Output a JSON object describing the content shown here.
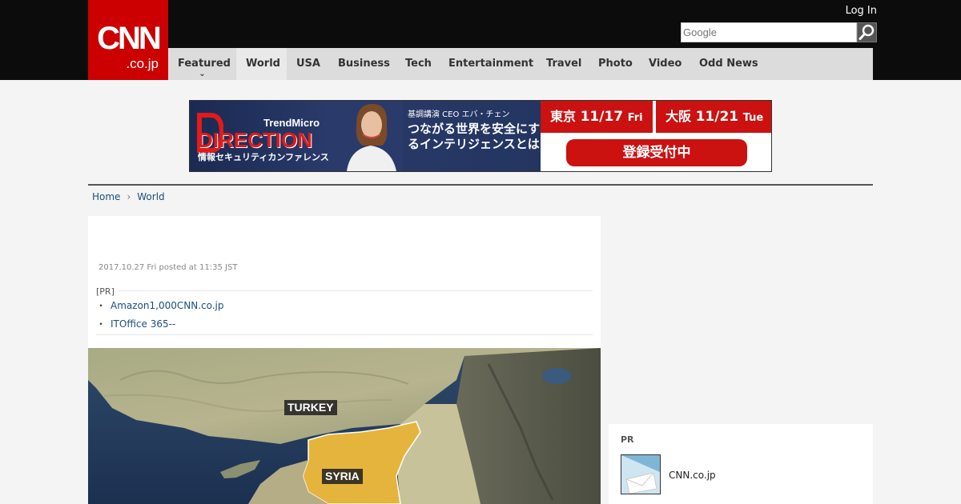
{
  "header": {
    "logo_main": "CNN",
    "logo_sub": ".co.jp",
    "login": "Log In",
    "search_placeholder": "Google"
  },
  "nav": [
    {
      "label": "Featured",
      "caret": "⌄"
    },
    {
      "label": "World"
    },
    {
      "label": "USA"
    },
    {
      "label": "Business"
    },
    {
      "label": "Tech"
    },
    {
      "label": "Entertainment"
    },
    {
      "label": "Travel"
    },
    {
      "label": "Photo"
    },
    {
      "label": "Video"
    },
    {
      "label": "Odd News"
    }
  ],
  "ad": {
    "brand": "TrendMicro",
    "title": "DIRECTION",
    "subtitle": "情報セキュリティカンファレンス",
    "speaker": "基調講演 CEO エバ・チェン",
    "headline": "つながる世界を安全にするインテリジェンスとは",
    "city1": "東京",
    "date1": "11/17",
    "day1": "Fri",
    "city2": "大阪",
    "date2": "11/21",
    "day2": "Tue",
    "cta": "登録受付中"
  },
  "breadcrumb": [
    {
      "label": "Home"
    },
    {
      "label": "World"
    }
  ],
  "breadcrumb_sep": "›",
  "article": {
    "date": "2017.10.27 Fri posted at 11:35 JST",
    "pr_label": "[PR]",
    "pr_bullet": "・",
    "pr_links": [
      {
        "label": "Amazon1,000CNN.co.jp"
      },
      {
        "label": "ITOffice 365--"
      }
    ]
  },
  "map": {
    "labels": [
      "TURKEY",
      "SYRIA"
    ]
  },
  "sidebar": {
    "title": "PR",
    "item_text": "CNN.co.jp"
  },
  "colors": {
    "brand_red": "#cc0000",
    "header_bg": "#0c0c0c",
    "nav_bg": "#dcdcdc",
    "link": "#1a4d80"
  }
}
